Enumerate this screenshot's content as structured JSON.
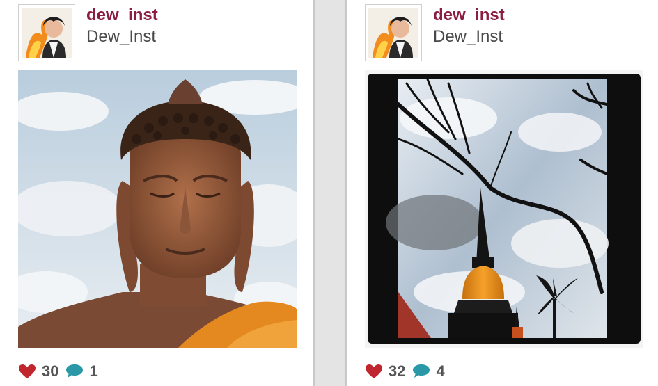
{
  "colors": {
    "username": "#8b1c43",
    "fullname": "#4a4a4a",
    "heart": "#c0262d",
    "comment": "#2a98a7",
    "count": "#555555"
  },
  "posts": [
    {
      "username": "dew_inst",
      "fullname": "Dew_Inst",
      "photo_subject": "buddha-statue",
      "likes": "30",
      "comments": "1",
      "like_icon": "heart-icon",
      "comment_icon": "speech-bubble-icon"
    },
    {
      "username": "dew_inst",
      "fullname": "Dew_Inst",
      "photo_subject": "pagoda-with-branches",
      "likes": "32",
      "comments": "4",
      "like_icon": "heart-icon",
      "comment_icon": "speech-bubble-icon"
    }
  ]
}
